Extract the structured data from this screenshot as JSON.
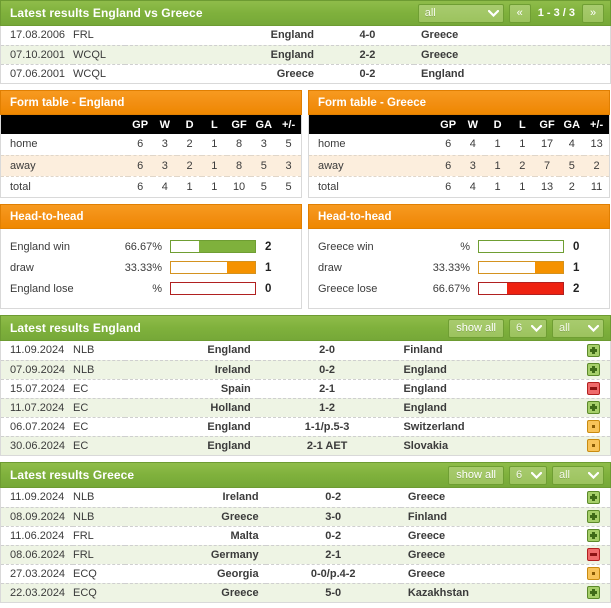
{
  "h2h_results": {
    "header": {
      "title": "Latest results England vs Greece",
      "filter_value": "all",
      "prev_label": "«",
      "next_label": "»",
      "page_info": "1 - 3 / 3"
    },
    "rows": [
      {
        "date": "17.08.2006",
        "competition": "FRL",
        "home": "England",
        "score": "4-0",
        "away": "Greece"
      },
      {
        "date": "07.10.2001",
        "competition": "WCQL",
        "home": "England",
        "score": "2-2",
        "away": "Greece"
      },
      {
        "date": "07.06.2001",
        "competition": "WCQL",
        "home": "Greece",
        "score": "0-2",
        "away": "England"
      }
    ]
  },
  "form_tables": [
    {
      "title": "Form table - England",
      "columns": [
        "GP",
        "W",
        "D",
        "L",
        "GF",
        "GA",
        "+/-"
      ],
      "rows": [
        {
          "label": "home",
          "values": [
            "6",
            "3",
            "2",
            "1",
            "8",
            "3",
            "5"
          ]
        },
        {
          "label": "away",
          "values": [
            "6",
            "3",
            "2",
            "1",
            "8",
            "5",
            "3"
          ]
        },
        {
          "label": "total",
          "values": [
            "6",
            "4",
            "1",
            "1",
            "10",
            "5",
            "5"
          ]
        }
      ]
    },
    {
      "title": "Form table - Greece",
      "columns": [
        "GP",
        "W",
        "D",
        "L",
        "GF",
        "GA",
        "+/-"
      ],
      "rows": [
        {
          "label": "home",
          "values": [
            "6",
            "4",
            "1",
            "1",
            "17",
            "4",
            "13"
          ]
        },
        {
          "label": "away",
          "values": [
            "6",
            "3",
            "1",
            "2",
            "7",
            "5",
            "2"
          ]
        },
        {
          "label": "total",
          "values": [
            "6",
            "4",
            "1",
            "1",
            "13",
            "2",
            "11"
          ]
        }
      ]
    }
  ],
  "head_to_head": [
    {
      "title": "Head-to-head",
      "rows": [
        {
          "label": "England win",
          "percent": "66.67%",
          "fill": 66.67,
          "color": "green",
          "count": "2"
        },
        {
          "label": "draw",
          "percent": "33.33%",
          "fill": 33.33,
          "color": "orange",
          "count": "1"
        },
        {
          "label": "England lose",
          "percent": "%",
          "fill": 0,
          "color": "red",
          "count": "0"
        }
      ]
    },
    {
      "title": "Head-to-head",
      "rows": [
        {
          "label": "Greece win",
          "percent": "%",
          "fill": 0,
          "color": "green",
          "count": "0"
        },
        {
          "label": "draw",
          "percent": "33.33%",
          "fill": 33.33,
          "color": "orange",
          "count": "1"
        },
        {
          "label": "Greece lose",
          "percent": "66.67%",
          "fill": 66.67,
          "color": "red",
          "count": "2"
        }
      ]
    }
  ],
  "latest_england": {
    "header": {
      "title": "Latest results England",
      "show_all_label": "show all",
      "count_value": "6",
      "filter_value": "all"
    },
    "rows": [
      {
        "date": "11.09.2024",
        "competition": "NLB",
        "home": "England",
        "score": "2-0",
        "away": "Finland",
        "status": "win"
      },
      {
        "date": "07.09.2024",
        "competition": "NLB",
        "home": "Ireland",
        "score": "0-2",
        "away": "England",
        "status": "win"
      },
      {
        "date": "15.07.2024",
        "competition": "EC",
        "home": "Spain",
        "score": "2-1",
        "away": "England",
        "status": "lose"
      },
      {
        "date": "11.07.2024",
        "competition": "EC",
        "home": "Holland",
        "score": "1-2",
        "away": "England",
        "status": "win"
      },
      {
        "date": "06.07.2024",
        "competition": "EC",
        "home": "England",
        "score": "1-1/p.5-3",
        "away": "Switzerland",
        "status": "draw"
      },
      {
        "date": "30.06.2024",
        "competition": "EC",
        "home": "England",
        "score": "2-1 AET",
        "away": "Slovakia",
        "status": "draw"
      }
    ]
  },
  "latest_greece": {
    "header": {
      "title": "Latest results Greece",
      "show_all_label": "show all",
      "count_value": "6",
      "filter_value": "all"
    },
    "rows": [
      {
        "date": "11.09.2024",
        "competition": "NLB",
        "home": "Ireland",
        "score": "0-2",
        "away": "Greece",
        "status": "win"
      },
      {
        "date": "08.09.2024",
        "competition": "NLB",
        "home": "Greece",
        "score": "3-0",
        "away": "Finland",
        "status": "win"
      },
      {
        "date": "11.06.2024",
        "competition": "FRL",
        "home": "Malta",
        "score": "0-2",
        "away": "Greece",
        "status": "win"
      },
      {
        "date": "08.06.2024",
        "competition": "FRL",
        "home": "Germany",
        "score": "2-1",
        "away": "Greece",
        "status": "lose"
      },
      {
        "date": "27.03.2024",
        "competition": "ECQ",
        "home": "Georgia",
        "score": "0-0/p.4-2",
        "away": "Greece",
        "status": "draw"
      },
      {
        "date": "22.03.2024",
        "competition": "ECQ",
        "home": "Greece",
        "score": "5-0",
        "away": "Kazakhstan",
        "status": "win"
      }
    ]
  }
}
